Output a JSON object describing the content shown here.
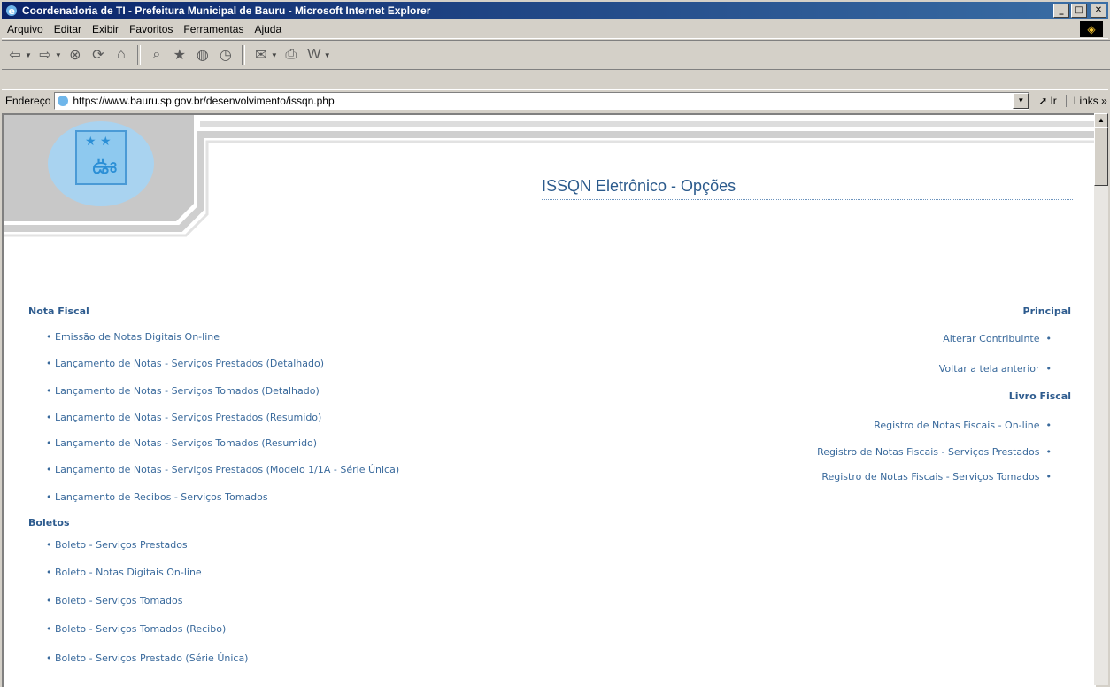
{
  "window": {
    "title": "Coordenadoria de TI - Prefeitura Municipal de Bauru - Microsoft Internet Explorer"
  },
  "menu": [
    "Arquivo",
    "Editar",
    "Exibir",
    "Favoritos",
    "Ferramentas",
    "Ajuda"
  ],
  "address": {
    "label": "Endereço",
    "url": "https://www.bauru.sp.gov.br/desenvolvimento/issqn.php",
    "go": "Ir",
    "links": "Links"
  },
  "page": {
    "heading": "ISSQN Eletrônico - Opções"
  },
  "left": {
    "nota_fiscal": {
      "title": "Nota Fiscal",
      "items": [
        "Emissão de Notas Digitais On-line",
        "Lançamento de Notas - Serviços Prestados (Detalhado)",
        "Lançamento de Notas - Serviços Tomados (Detalhado)",
        "Lançamento de Notas - Serviços Prestados (Resumido)",
        "Lançamento de Notas - Serviços Tomados (Resumido)",
        "Lançamento de Notas - Serviços Prestados (Modelo 1/1A - Série Única)",
        "Lançamento de Recibos - Serviços Tomados"
      ]
    },
    "boletos": {
      "title": "Boletos",
      "items": [
        "Boleto - Serviços Prestados",
        "Boleto - Notas Digitais On-line",
        "Boleto - Serviços Tomados",
        "Boleto - Serviços Tomados (Recibo)",
        "Boleto - Serviços Prestado (Série Única)"
      ]
    }
  },
  "right": {
    "principal": {
      "title": "Principal",
      "items": [
        "Alterar Contribuinte",
        "Voltar a tela anterior"
      ]
    },
    "livro_fiscal": {
      "title": "Livro Fiscal",
      "items": [
        "Registro de Notas Fiscais - On-line",
        "Registro de Notas Fiscais - Serviços Prestados",
        "Registro de Notas Fiscais - Serviços Tomados"
      ]
    }
  },
  "colors": {
    "link": "#3a6a9c",
    "heading": "#2b5a8c",
    "titlebar": "#0a246a"
  }
}
